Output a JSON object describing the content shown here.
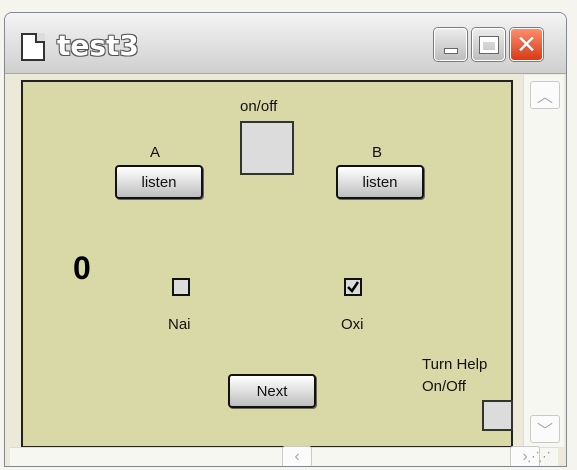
{
  "window": {
    "title": "test3",
    "icon": "document-icon",
    "controls": {
      "minimize": "minimize-icon",
      "maximize": "maximize-icon",
      "close": "close-icon"
    }
  },
  "canvas": {
    "background": "#d9d9a8",
    "onoff_label": "on/off",
    "a_label": "A",
    "b_label": "B",
    "listen_a": "listen",
    "listen_b": "listen",
    "counter": "0",
    "nai_label": "Nai",
    "oxi_label": "Oxi",
    "nai_checked": false,
    "oxi_checked": true,
    "next_label": "Next",
    "help_line1": "Turn Help",
    "help_line2": "On/Off"
  },
  "scrollbars": {
    "up_icon": "chevron-up-icon",
    "down_icon": "chevron-down-icon",
    "left_icon": "chevron-left-icon",
    "right_icon": "chevron-right-icon"
  }
}
